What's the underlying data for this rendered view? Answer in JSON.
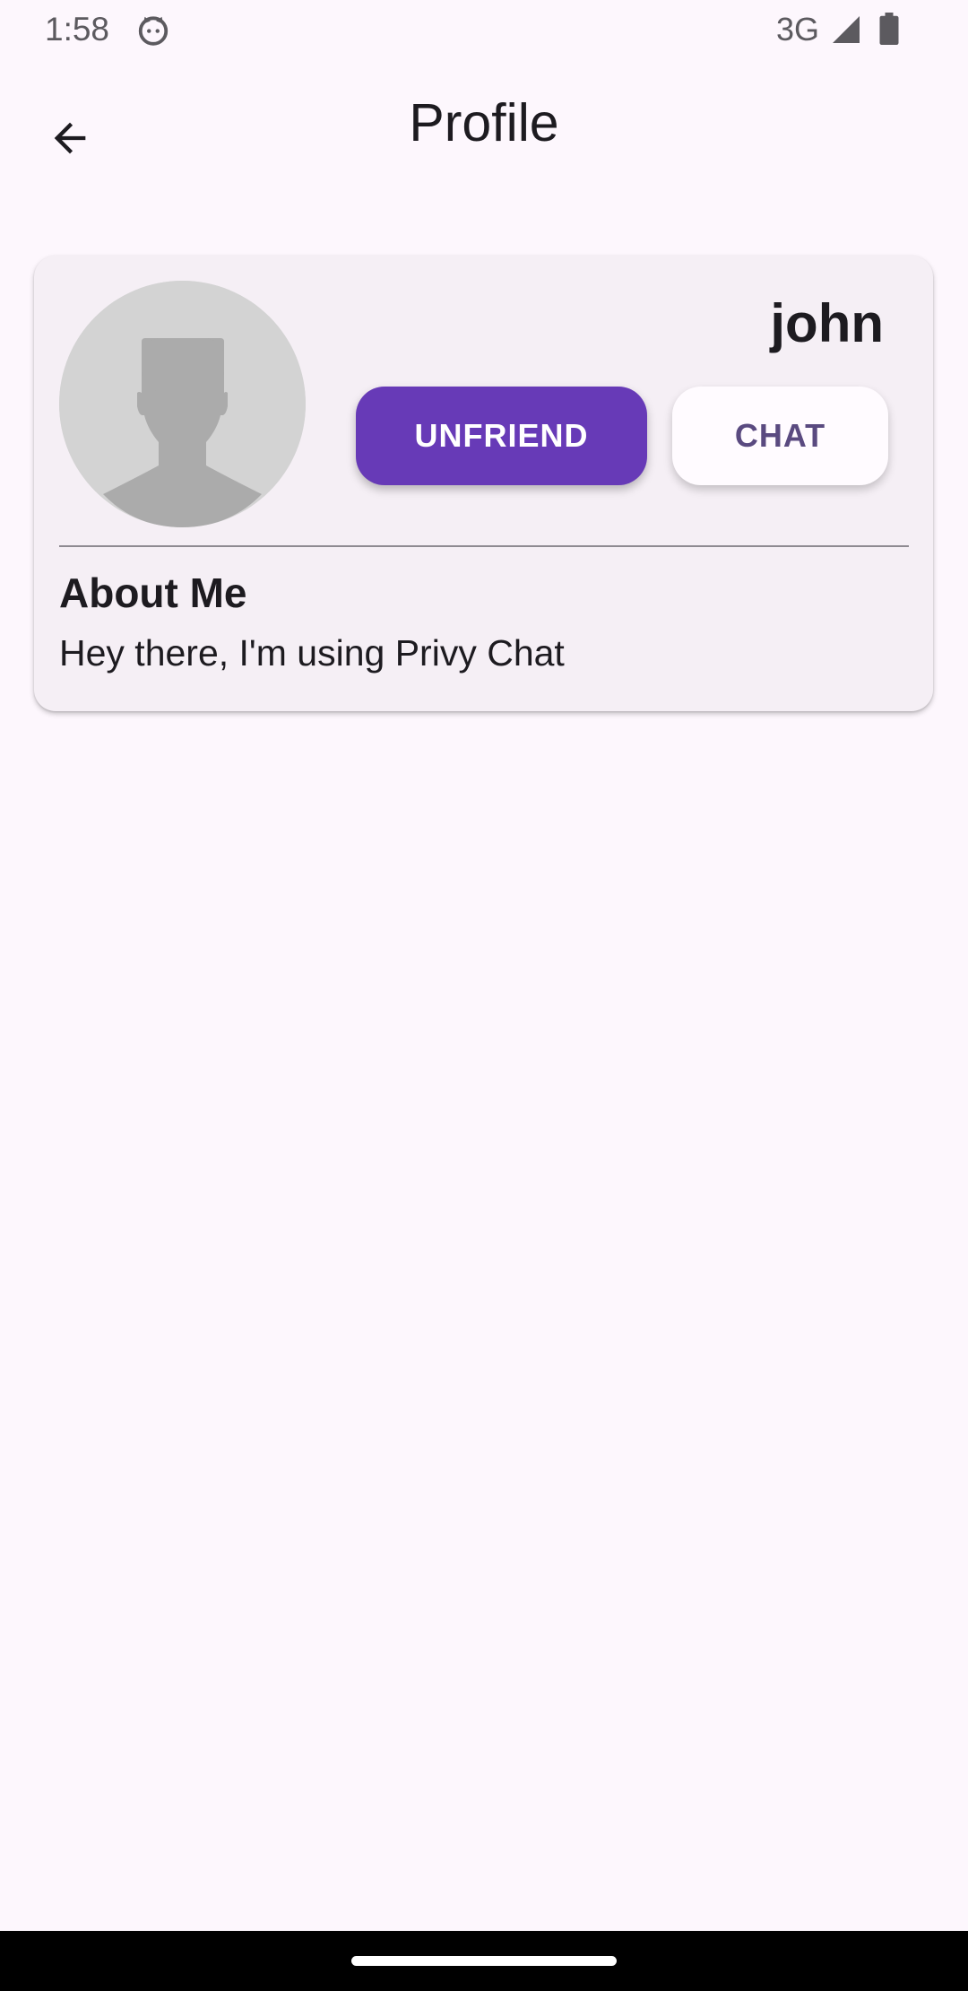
{
  "status_bar": {
    "time": "1:58",
    "network": "3G",
    "icons": [
      "cat-face-icon",
      "signal-icon",
      "battery-icon"
    ]
  },
  "app_bar": {
    "title": "Profile",
    "back_icon": "arrow-back-icon"
  },
  "profile": {
    "username": "john",
    "avatar_icon": "default-person-icon",
    "unfriend_label": "UNFRIEND",
    "chat_label": "CHAT",
    "about_title": "About Me",
    "about_text": "Hey there, I'm using Privy Chat"
  },
  "colors": {
    "background": "#fdf7fd",
    "card": "#f5eff5",
    "primary": "#673ab7",
    "chat_text": "#5a4a80",
    "text": "#1d1b20"
  }
}
